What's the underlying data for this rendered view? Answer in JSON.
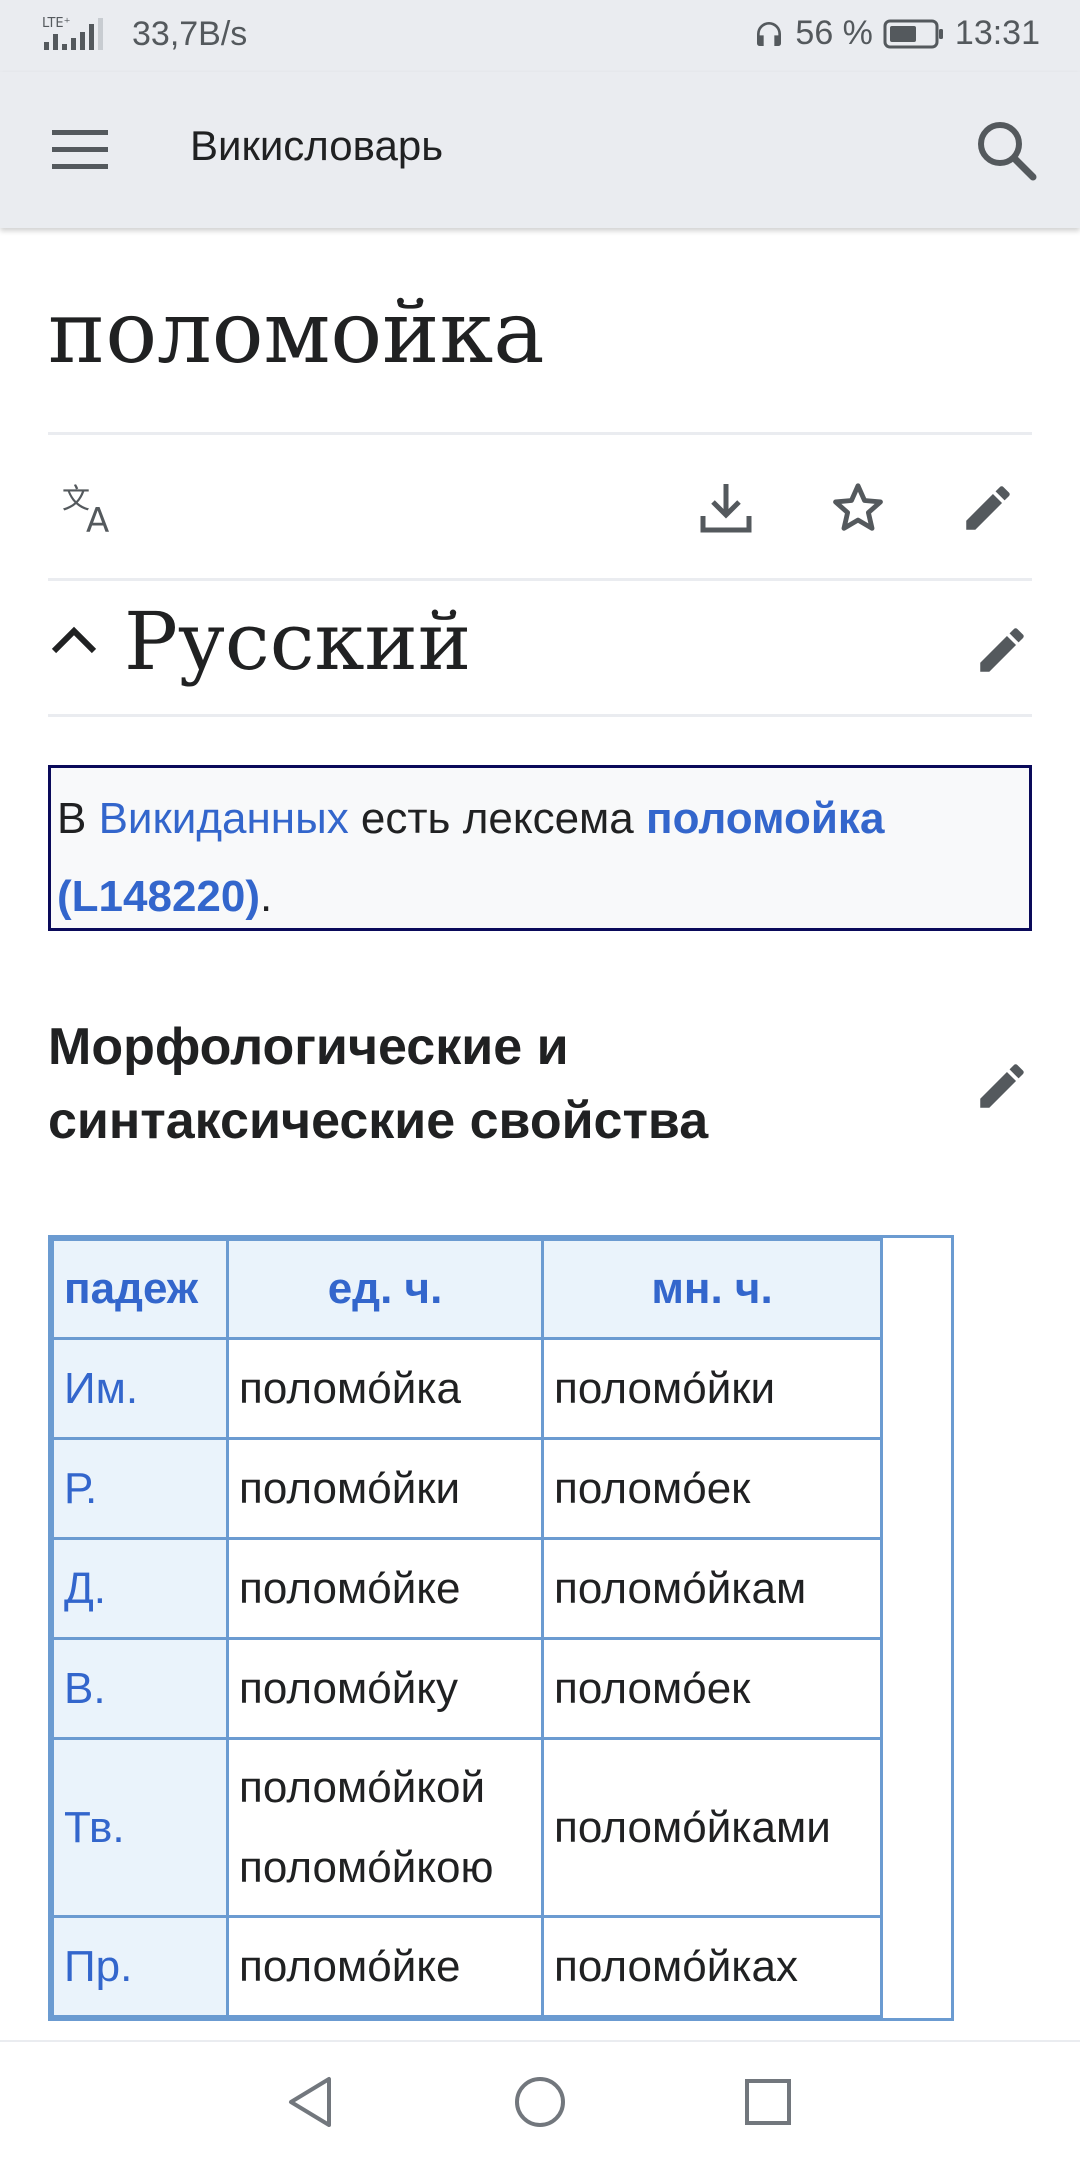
{
  "status_bar": {
    "network_type": "LTE⁺",
    "speed": "33,7B/s",
    "battery": "56 %",
    "time": "13:31"
  },
  "app_bar": {
    "title": "Викисловарь",
    "menu_icon": "hamburger-menu-icon",
    "search_icon": "search-icon"
  },
  "page": {
    "title": "поломойка",
    "actions": [
      "language-icon",
      "download-icon",
      "star-icon",
      "edit-icon"
    ]
  },
  "section": {
    "title": "Русский",
    "toggle_icon": "chevron-up-icon"
  },
  "wikidata_box": {
    "prefix": "В ",
    "link": "Викиданных",
    "middle": " есть лексема ",
    "lexeme": "поломойка",
    "lexeme_id": "(L148220)",
    "suffix": "."
  },
  "subsection": {
    "title": "Морфологические и синтаксические свойства"
  },
  "declension_table": {
    "headers": [
      "падеж",
      "ед. ч.",
      "мн. ч."
    ],
    "rows": [
      {
        "case": "Им.",
        "singular": [
          "поломо́йка"
        ],
        "plural": "поломо́йки"
      },
      {
        "case": "Р.",
        "singular": [
          "поломо́йки"
        ],
        "plural": "поломо́ек"
      },
      {
        "case": "Д.",
        "singular": [
          "поломо́йке"
        ],
        "plural": "поломо́йкам"
      },
      {
        "case": "В.",
        "singular": [
          "поломо́йку"
        ],
        "plural": "поломо́ек"
      },
      {
        "case": "Тв.",
        "singular": [
          "поломо́йкой",
          "поломо́йкою"
        ],
        "plural": "поломо́йками"
      },
      {
        "case": "Пр.",
        "singular": [
          "поломо́йке"
        ],
        "plural": "поломо́йках"
      }
    ]
  },
  "nav_bar": {
    "buttons": [
      "back-icon",
      "home-icon",
      "recents-icon"
    ]
  },
  "colors": {
    "link": "#3366cc",
    "chrome_bg": "#eaecf0",
    "table_border": "#6b9bd1",
    "table_header_bg": "#eaf3fb"
  }
}
